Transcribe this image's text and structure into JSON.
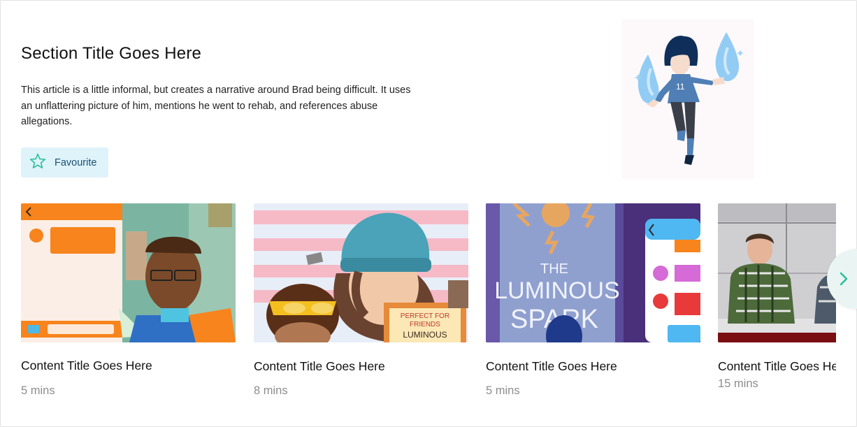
{
  "section": {
    "title": "Section Title Goes Here",
    "description": "This article is a little informal, but creates a narrative around Brad being difficult. It uses an unflattering picture of him, mentions he went to rehab, and references abuse allegations.",
    "favourite_label": "Favourite"
  },
  "cards": [
    {
      "title": "Content Title Goes Here",
      "duration": "5 mins",
      "thumbnail": "comic-chat-phone"
    },
    {
      "title": "Content Title Goes Here",
      "duration": "8 mins",
      "thumbnail": "comic-beanie-friends"
    },
    {
      "title": "Content Title Goes Here",
      "duration": "5 mins",
      "thumbnail": "comic-luminous-spark"
    },
    {
      "title": "Content Title Goes Here",
      "duration": "15 mins",
      "thumbnail": "photo-panel-men"
    }
  ],
  "icons": {
    "favourite": "star-outline-icon",
    "next": "chevron-right-icon"
  },
  "colors": {
    "accent": "#2bbf9a",
    "favourite_bg": "#dff3fb",
    "favourite_text": "#1b4f73",
    "meta": "#8d8d8d"
  }
}
